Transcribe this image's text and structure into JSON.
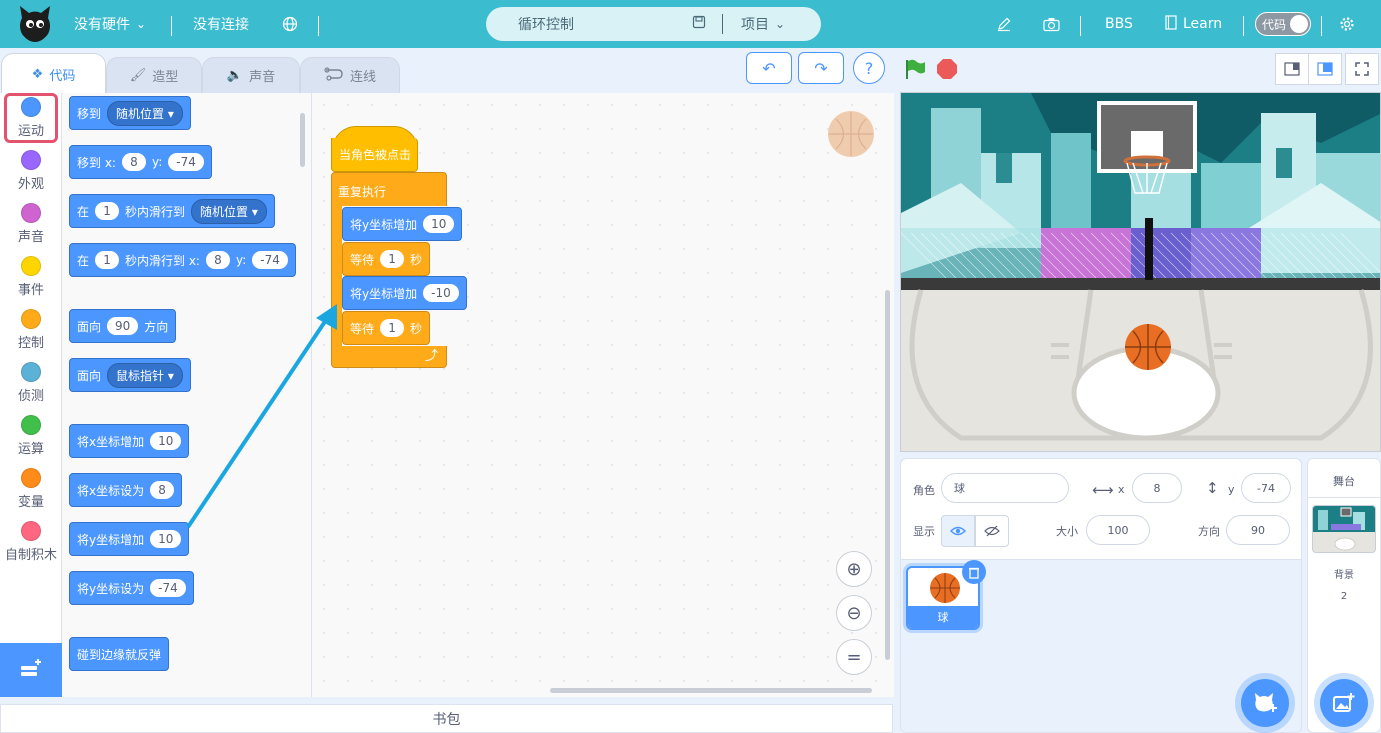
{
  "topbar": {
    "hardware": "没有硬件",
    "connection": "没有连接",
    "project_title": "循环控制",
    "project_menu": "项目",
    "bbs": "BBS",
    "learn": "Learn",
    "code_toggle": "代码"
  },
  "tabs": [
    "代码",
    "造型",
    "声音",
    "连线"
  ],
  "categories": [
    {
      "label": "运动",
      "color": "#4c97ff"
    },
    {
      "label": "外观",
      "color": "#9966ff"
    },
    {
      "label": "声音",
      "color": "#cf63cf"
    },
    {
      "label": "事件",
      "color": "#ffd500"
    },
    {
      "label": "控制",
      "color": "#ffab19"
    },
    {
      "label": "侦测",
      "color": "#5cb1d6"
    },
    {
      "label": "运算",
      "color": "#40bf4a"
    },
    {
      "label": "变量",
      "color": "#ff8c1a"
    },
    {
      "label": "自制积木",
      "color": "#ff6680"
    }
  ],
  "palette": {
    "goto_label": "移到",
    "goto_value": "随机位置",
    "gotoxy_label": "移到 x:",
    "gotoxy_x": "8",
    "y_label": "y:",
    "gotoxy_y": "-74",
    "glide_in": "在",
    "glide1_secs": "1",
    "glide1_mid": "秒内滑行到",
    "glide1_value": "随机位置",
    "glide2_secs": "1",
    "glide2_mid": "秒内滑行到 x:",
    "glide2_x": "8",
    "glide2_y": "-74",
    "point_label": "面向",
    "point_value": "90",
    "point_suffix": "方向",
    "towards_label": "面向",
    "towards_value": "鼠标指针",
    "changex_label": "将x坐标增加",
    "changex_value": "10",
    "setx_label": "将x坐标设为",
    "setx_value": "8",
    "changey_label": "将y坐标增加",
    "changey_value": "10",
    "sety_label": "将y坐标设为",
    "sety_value": "-74",
    "bounce_label": "碰到边缘就反弹"
  },
  "script": {
    "hat": "当角色被点击",
    "forever": "重复执行",
    "change1_label": "将y坐标增加",
    "change1_value": "10",
    "wait1_label": "等待",
    "wait1_value": "1",
    "wait1_unit": "秒",
    "change2_label": "将y坐标增加",
    "change2_value": "-10",
    "wait2_label": "等待",
    "wait2_value": "1",
    "wait2_unit": "秒"
  },
  "backpack": "书包",
  "sprite_info": {
    "sprite_label": "角色",
    "sprite_name": "球",
    "x_label": "x",
    "x_value": "8",
    "y_label": "y",
    "y_value": "-74",
    "show_label": "显示",
    "size_label": "大小",
    "size_value": "100",
    "direction_label": "方向",
    "direction_value": "90"
  },
  "sprite_tile": {
    "name": "球"
  },
  "stage_pane": {
    "title": "舞台",
    "backdrop_label": "背景",
    "backdrop_count": "2"
  }
}
